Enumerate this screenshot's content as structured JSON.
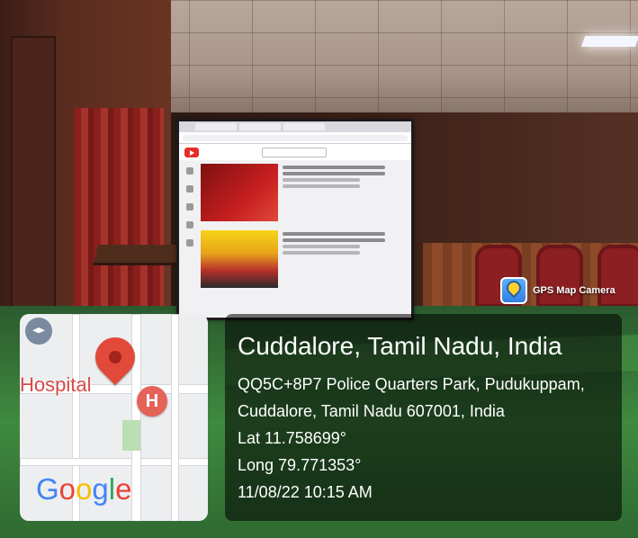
{
  "badge": {
    "label": "GPS Map Camera",
    "icon": "gps-map-camera-icon"
  },
  "map": {
    "place_label": "Hospital",
    "marker_letter": "H",
    "logo": [
      "G",
      "o",
      "o",
      "g",
      "l",
      "e"
    ],
    "logo_colors": [
      "#4285f4",
      "#ea4335",
      "#fbbc05",
      "#4285f4",
      "#34a853",
      "#ea4335"
    ]
  },
  "location": {
    "title": "Cuddalore, Tamil Nadu, India",
    "address_line1": "QQ5C+8P7 Police Quarters Park, Pudukuppam,",
    "address_line2": "Cuddalore, Tamil Nadu 607001, India",
    "lat": "Lat 11.758699°",
    "long": "Long 79.771353°",
    "datetime": "11/08/22 10:15 AM"
  }
}
